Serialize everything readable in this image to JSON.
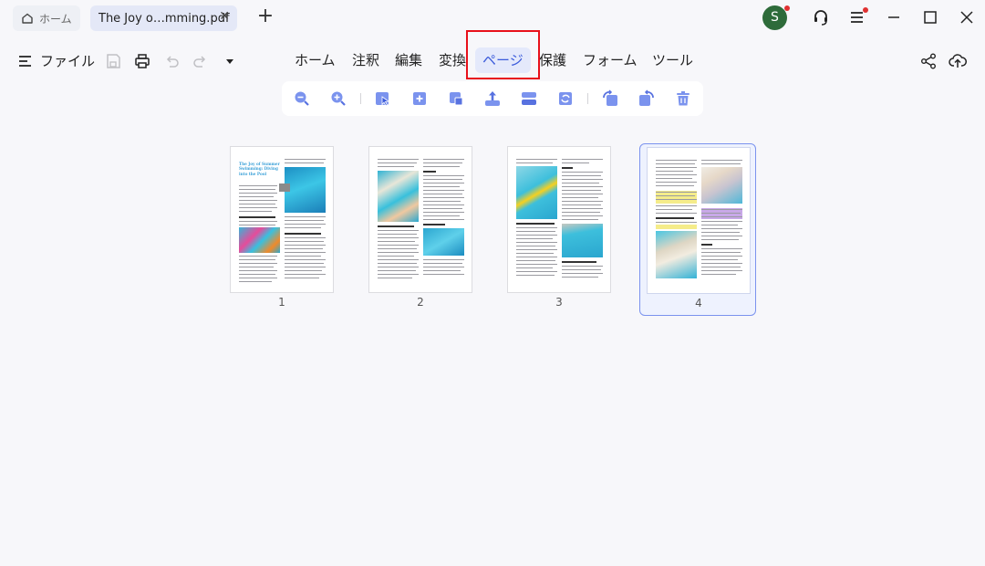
{
  "titlebar": {
    "home_tab_label": "ホーム",
    "doc_tab_label": "The Joy o…mming.pdf",
    "close_glyph": "✕",
    "new_tab_glyph": "+",
    "avatar_initial": "S"
  },
  "menubar": {
    "file_label": "ファイル",
    "tabs": [
      {
        "label": "ホーム"
      },
      {
        "label": "注釈"
      },
      {
        "label": "編集"
      },
      {
        "label": "変換"
      },
      {
        "label": "ページ",
        "active": true
      },
      {
        "label": "保護"
      },
      {
        "label": "フォーム"
      },
      {
        "label": "ツール"
      }
    ]
  },
  "toolbar": {
    "icons": [
      "zoom-out-icon",
      "zoom-in-icon",
      "select-icon",
      "insert-page-icon",
      "crop-page-icon",
      "extract-page-icon",
      "split-page-icon",
      "replace-page-icon",
      "rotate-left-icon",
      "rotate-right-icon",
      "delete-page-icon"
    ]
  },
  "pages": [
    {
      "number": "1",
      "title": "The Joy of Summer Swimming: Diving into the Pool",
      "selected": false
    },
    {
      "number": "2",
      "selected": false
    },
    {
      "number": "3",
      "selected": false
    },
    {
      "number": "4",
      "selected": true
    }
  ],
  "colors": {
    "accent": "#3b5bdb",
    "active_tab_bg": "#e4e9fb",
    "highlight_box": "#e8101a",
    "avatar": "#2e6b3a",
    "notification": "#e03131",
    "selected_border": "#7b93ee"
  }
}
